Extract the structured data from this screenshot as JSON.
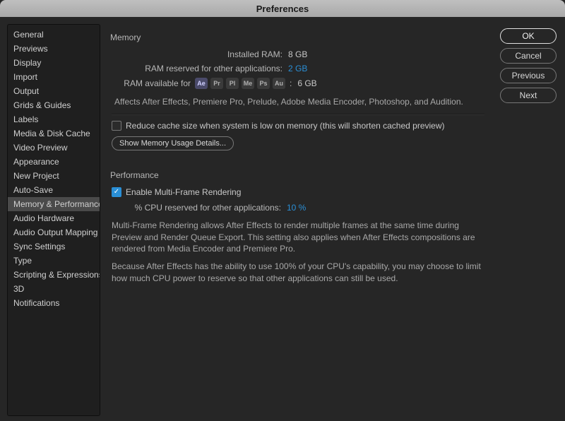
{
  "window": {
    "title": "Preferences"
  },
  "buttons": {
    "ok": "OK",
    "cancel": "Cancel",
    "previous": "Previous",
    "next": "Next"
  },
  "sidebar": {
    "items": [
      {
        "label": "General"
      },
      {
        "label": "Previews"
      },
      {
        "label": "Display"
      },
      {
        "label": "Import"
      },
      {
        "label": "Output"
      },
      {
        "label": "Grids & Guides"
      },
      {
        "label": "Labels"
      },
      {
        "label": "Media & Disk Cache"
      },
      {
        "label": "Video Preview"
      },
      {
        "label": "Appearance"
      },
      {
        "label": "New Project"
      },
      {
        "label": "Auto-Save"
      },
      {
        "label": "Memory & Performance"
      },
      {
        "label": "Audio Hardware"
      },
      {
        "label": "Audio Output Mapping"
      },
      {
        "label": "Sync Settings"
      },
      {
        "label": "Type"
      },
      {
        "label": "Scripting & Expressions"
      },
      {
        "label": "3D"
      },
      {
        "label": "Notifications"
      }
    ],
    "selected_index": 12
  },
  "memory": {
    "heading": "Memory",
    "installed_label": "Installed RAM:",
    "installed_value": "8 GB",
    "reserved_label": "RAM reserved for other applications:",
    "reserved_value": "2 GB",
    "available_label": "RAM available for",
    "available_value": "6 GB",
    "apps": [
      "Ae",
      "Pr",
      "Pl",
      "Me",
      "Ps",
      "Au"
    ],
    "affects_text": "Affects After Effects, Premiere Pro, Prelude, Adobe Media Encoder, Photoshop, and Audition.",
    "reduce_cache_label": "Reduce cache size when system is low on memory (this will shorten cached preview)",
    "reduce_cache_checked": false,
    "show_details_label": "Show Memory Usage Details..."
  },
  "performance": {
    "heading": "Performance",
    "enable_mfr_label": "Enable Multi-Frame Rendering",
    "enable_mfr_checked": true,
    "cpu_reserved_label": "% CPU reserved for other applications:",
    "cpu_reserved_value": "10 %",
    "desc1": "Multi-Frame Rendering allows After Effects to render multiple frames at the same time during Preview and Render Queue Export. This setting also applies when After Effects compositions are rendered from Media Encoder and Premiere Pro.",
    "desc2": "Because After Effects has the ability to use 100% of your CPU's capability, you may choose to limit how much CPU power to reserve so that other applications can still be used."
  }
}
